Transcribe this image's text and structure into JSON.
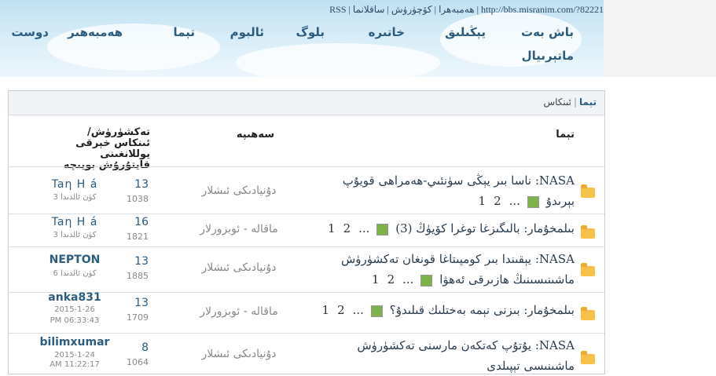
{
  "topbar": {
    "url": "http://bbs.misranim.com/?82221",
    "separator": "|",
    "links": [
      "ساقلانما",
      "كۆچۈرۈش",
      "ھەمبەھرا",
      "RSS"
    ]
  },
  "nav": {
    "items": [
      "باش بەت",
      "يېڭىلىق",
      "خاتىرە",
      "بلوگ",
      "ئالبوم",
      "تېما",
      "ھەمبەھىر",
      "دوست",
      "ماتېرىيال"
    ]
  },
  "breadcrumb": {
    "current": "تېما",
    "separator": "|",
    "item": "ئىنكاس"
  },
  "columns": {
    "topic": "تېما",
    "category": "سەھىپە",
    "stats": "تەكشۈرۈش/ئىنكاس",
    "last": "خېرقى يوللانغىنى قايتۇرۇش بويىچە"
  },
  "colors": {
    "link": "#2c5d80",
    "folder": "#f5c149",
    "header_sky": "#bfe0f1"
  },
  "topics": [
    {
      "prefix": "NASA:",
      "text": "ناسا بىر يېڭى سۈنئىي-ھەمراھى قويۇپ بېرىدۇ",
      "pages": [
        "1",
        "2"
      ],
      "ellipsis": "...",
      "category": "دۇنيادىكى ئىشلار",
      "replies": "13",
      "views": "1038",
      "author": "Taη Η á",
      "date": "3 كۈن ئالدىدا"
    },
    {
      "prefix": "بىلمخۇمار:",
      "text": "بالىگىزغا توغرا كۆيۈڭ (3)",
      "pages": [
        "1",
        "2"
      ],
      "ellipsis": "...",
      "category": "ماقالە - ئوبزورلار",
      "replies": "16",
      "views": "1821",
      "author": "Taη Η á",
      "date": "3 كۈن ئالدىدا"
    },
    {
      "prefix": "NASA:",
      "text": "يېقىندا بىر كومپىتاغا قونغان تەكشۈرۈش ماشىنىسىنىڭ ھازىرقى ئەھۋا",
      "pages": [
        "1",
        "2"
      ],
      "ellipsis": "...",
      "category": "دۇنيادىكى ئىشلار",
      "replies": "13",
      "views": "1885",
      "author": "NEPTON",
      "date": "6 كۈن ئالدىدا"
    },
    {
      "prefix": "بىلمخۇمار:",
      "text": "بىزنى نېمە بەختلىك قىلىدۇ؟",
      "pages": [
        "1",
        "2"
      ],
      "ellipsis": "...",
      "category": "ماقالە - ئوبزورلار",
      "replies": "13",
      "views": "1709",
      "author": "anka831",
      "date": "2015-1-26",
      "time": "PM 06:33:43"
    },
    {
      "prefix": "NASA:",
      "text": "يۇتۇپ كەتكەن مارسنى تەكشۈرۈش ماشىنىسى تېپىلدى",
      "pages": [],
      "ellipsis": "",
      "category": "دۇنيادىكى ئىشلار",
      "replies": "8",
      "views": "1064",
      "author": "bilimxumar",
      "date": "2015-1-24",
      "time": "AM 11:22:17"
    }
  ]
}
